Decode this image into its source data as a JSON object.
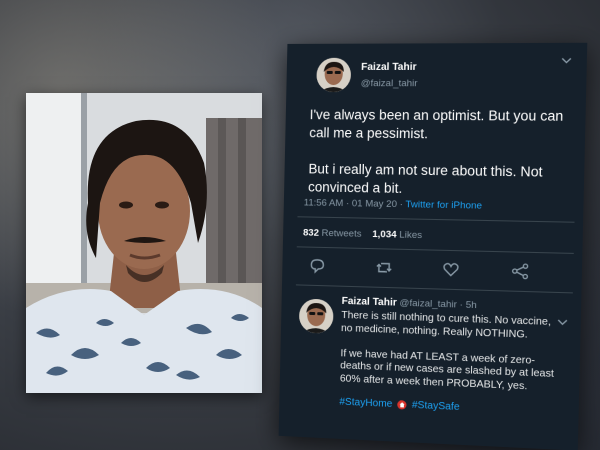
{
  "tweet": {
    "display_name": "Faizal Tahir",
    "handle": "@faizal_tahir",
    "text_line1": "I've always been an optimist. But you can call me a pessimist.",
    "text_line2": "But i really am not sure about this. Not convinced a bit.",
    "timestamp": "11:56 AM · 01 May 20",
    "separator": " · ",
    "source": "Twitter for iPhone",
    "retweets_count": "832",
    "retweets_label": "Retweets",
    "likes_count": "1,034",
    "likes_label": "Likes",
    "actions": [
      "reply-icon",
      "retweet-icon",
      "like-icon",
      "share-icon"
    ]
  },
  "reply": {
    "display_name": "Faizal Tahir",
    "handle": "@faizal_tahir",
    "age": "· 5h",
    "para1": "There is still nothing to cure this. No vaccine, no medicine, nothing. Really NOTHING.",
    "para2": "If we have had AT LEAST a week of zero-deaths or if new cases are slashed by at least 60% after a week then PROBABLY, yes.",
    "hashtag1": "#StayHome",
    "hashtag2": "#StaySafe"
  },
  "colors": {
    "panel_bg": "#15202b",
    "accent": "#1da1f2",
    "muted": "#8899a6"
  }
}
